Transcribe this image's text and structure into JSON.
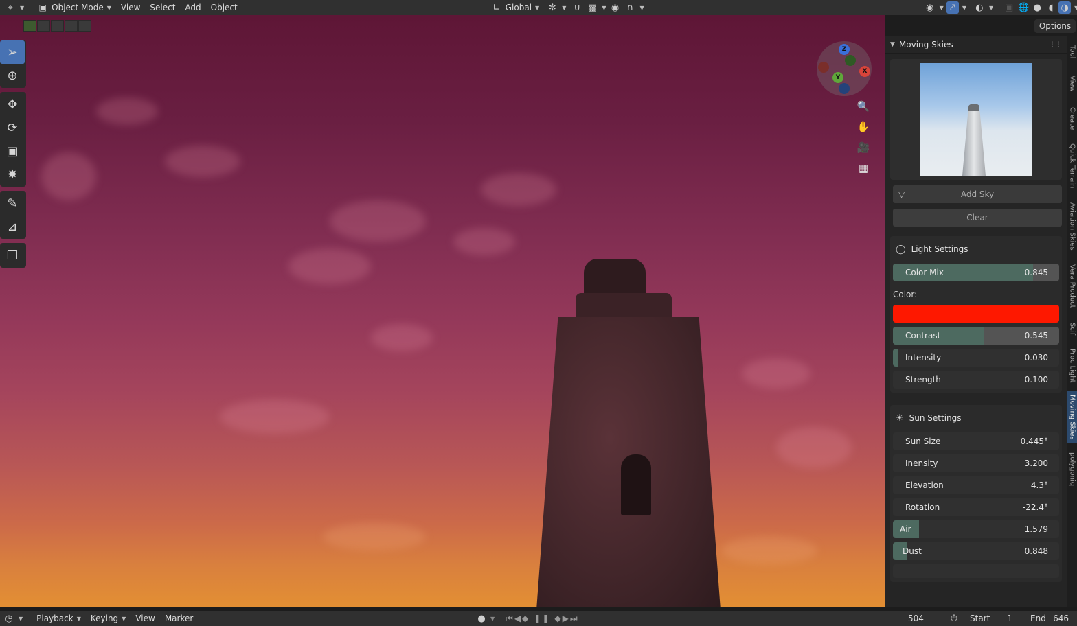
{
  "topbar": {
    "mode": "Object Mode",
    "menu": [
      "View",
      "Select",
      "Add",
      "Object"
    ],
    "orientation": "Global",
    "icons": [
      "editor-type-icon",
      "object-mode-icon",
      "transform-orientation-icon",
      "pivot-icon",
      "snap-icon",
      "snap-target-icon",
      "proportional-edit-icon",
      "falloff-icon",
      "visibility-icon",
      "gizmo-icon",
      "overlay-icon",
      "xray-icon",
      "wireframe-shading-icon",
      "solid-shading-icon",
      "material-shading-icon",
      "rendered-shading-icon",
      "pause-icon"
    ]
  },
  "viewport": {
    "options_label": "Options"
  },
  "gizmo": {
    "axes": [
      "Z",
      "X",
      "Y"
    ]
  },
  "npanel": {
    "title": "Moving Skies",
    "buttons": {
      "add_sky": "Add Sky",
      "clear": "Clear"
    },
    "light_settings": {
      "title": "Light Settings",
      "color_mix": {
        "label": "Color Mix",
        "value": "0.845",
        "fraction": 0.845
      },
      "color_label": "Color:",
      "color": "#fe1800",
      "contrast": {
        "label": "Contrast",
        "value": "0.545",
        "fraction": 0.545
      },
      "intensity": {
        "label": "Intensity",
        "value": "0.030",
        "fraction": 0.03
      },
      "strength": {
        "label": "Strength",
        "value": "0.100"
      }
    },
    "sun_settings": {
      "title": "Sun Settings",
      "sun_size": {
        "label": "Sun Size",
        "value": "0.445°"
      },
      "inensity": {
        "label": "Inensity",
        "value": "3.200"
      },
      "elevation": {
        "label": "Elevation",
        "value": "4.3°"
      },
      "rotation": {
        "label": "Rotation",
        "value": "-22.4°"
      },
      "air": {
        "label": "Air",
        "value": "1.579",
        "fraction": 0.158
      },
      "dust": {
        "label": "Dust",
        "value": "0.848",
        "fraction": 0.085
      }
    }
  },
  "vtabs": [
    "Tool",
    "View",
    "Create",
    "Quick Terrain",
    "Aviation Skies",
    "Vera Product",
    "Scifi",
    "Proc Light",
    "Moving Skies",
    "polygoniq"
  ],
  "timeline": {
    "menu": [
      "Playback",
      "Keying",
      "View",
      "Marker"
    ],
    "current_frame": "504",
    "start_label": "Start",
    "start": "1",
    "end_label": "End",
    "end": "646"
  },
  "colors": {
    "accent": "#4772b3",
    "slider_fill": "#4d6a60",
    "active_tab": "#2c4a6e"
  }
}
